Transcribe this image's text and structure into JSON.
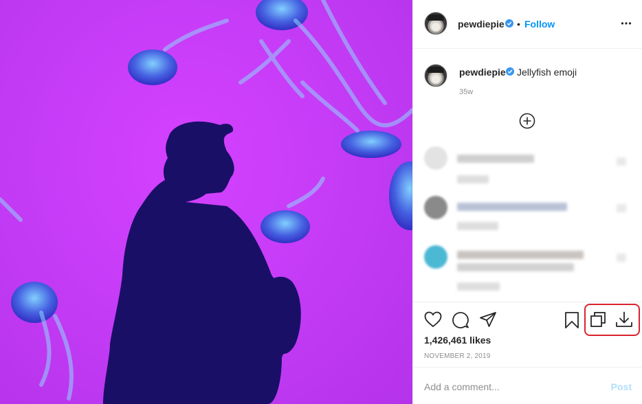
{
  "post": {
    "image_description_icon": "jellyfish-photo",
    "author": {
      "username": "pewdiepie",
      "verified": true
    },
    "header": {
      "separator": "•",
      "follow_label": "Follow",
      "more_icon": "more-options-icon"
    },
    "caption": {
      "username": "pewdiepie",
      "text": "Jellyfish emoji",
      "time": "35w"
    },
    "load_more_icon": "plus-circle-icon",
    "likes": "1,426,461 likes",
    "date": "NOVEMBER 2, 2019",
    "comment_box": {
      "placeholder": "Add a comment...",
      "post_label": "Post"
    },
    "action_icons": [
      "heart-icon",
      "comment-icon",
      "share-icon",
      "bookmark-icon",
      "copy-icon",
      "download-icon"
    ],
    "colors": {
      "accent": "#0095f6",
      "highlight": "#d9232e",
      "photo_bg": "#c63cf7"
    }
  }
}
